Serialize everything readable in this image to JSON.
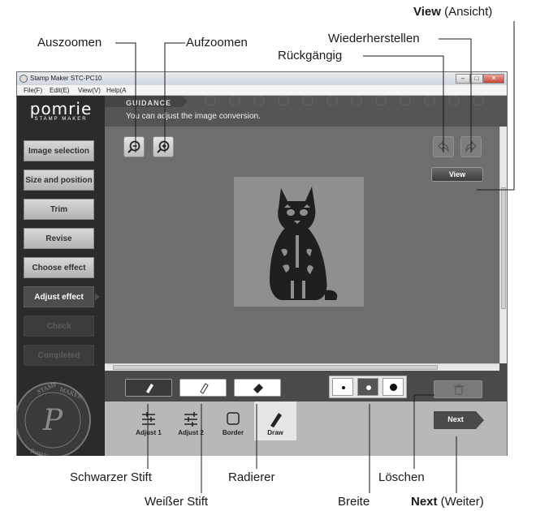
{
  "callouts": {
    "view_bold": "View",
    "view_rest": " (Ansicht)",
    "redo": "Wiederherstellen",
    "undo": "Rückgängig",
    "zoom_out": "Auszoomen",
    "zoom_in": "Aufzoomen",
    "black_pen": "Schwarzer Stift",
    "white_pen": "Weißer Stift",
    "eraser": "Radierer",
    "delete": "Löschen",
    "width": "Breite",
    "next_bold": "Next",
    "next_rest": " (Weiter)"
  },
  "window": {
    "title": "Stamp Maker STC-PC10",
    "menu": [
      "File(F)",
      "Edit(E)",
      "View(V)",
      "Help(A"
    ]
  },
  "logo": {
    "brand": "pomrie",
    "sub": "STAMP MAKER"
  },
  "steps": [
    {
      "label": "Image selection",
      "state": "done"
    },
    {
      "label": "Size and position",
      "state": "done"
    },
    {
      "label": "Trim",
      "state": "done"
    },
    {
      "label": "Revise",
      "state": "done"
    },
    {
      "label": "Choose effect",
      "state": "done"
    },
    {
      "label": "Adjust effect",
      "state": "active"
    },
    {
      "label": "Check",
      "state": "pending"
    },
    {
      "label": "Completed",
      "state": "pending"
    }
  ],
  "guidance": {
    "label": "GUIDANCE",
    "text": "You can adjust the image conversion."
  },
  "view_button": "View",
  "tabs": [
    {
      "label": "Adjust 1",
      "icon": "adjust1-icon"
    },
    {
      "label": "Adjust 2",
      "icon": "adjust2-icon"
    },
    {
      "label": "Border",
      "icon": "border-icon"
    },
    {
      "label": "Draw",
      "icon": "pencil-icon"
    }
  ],
  "next_button": "Next",
  "colors": {
    "accent": "#3a3a3a",
    "active_step": "#4d4d4d",
    "canvas": "#6e6e6e"
  }
}
